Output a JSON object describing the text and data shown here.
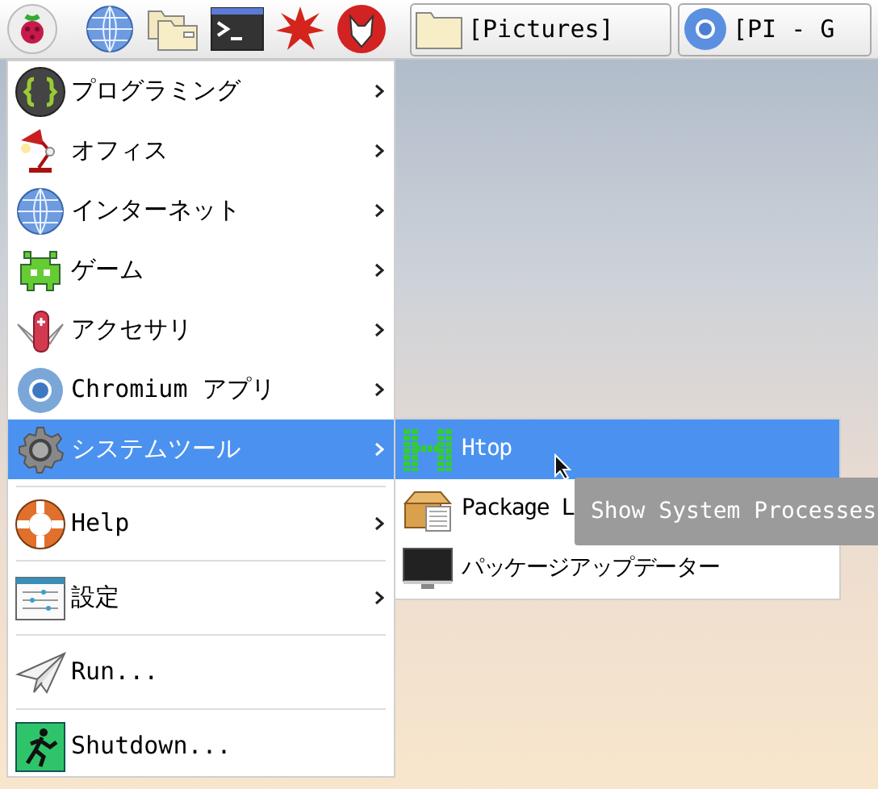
{
  "taskbar": {
    "tasks": [
      {
        "label": "[Pictures]",
        "selected": false
      },
      {
        "label": "[PI - G",
        "selected": false
      }
    ]
  },
  "menu": {
    "groups": [
      [
        {
          "label": "プログラミング",
          "has_submenu": true,
          "selected": false
        },
        {
          "label": "オフィス",
          "has_submenu": true,
          "selected": false
        },
        {
          "label": "インターネット",
          "has_submenu": true,
          "selected": false
        },
        {
          "label": "ゲーム",
          "has_submenu": true,
          "selected": false
        },
        {
          "label": "アクセサリ",
          "has_submenu": true,
          "selected": false
        },
        {
          "label": "Chromium アプリ",
          "has_submenu": true,
          "selected": false
        },
        {
          "label": "システムツール",
          "has_submenu": true,
          "selected": true
        }
      ],
      [
        {
          "label": "Help",
          "has_submenu": true,
          "selected": false
        }
      ],
      [
        {
          "label": "設定",
          "has_submenu": true,
          "selected": false
        }
      ],
      [
        {
          "label": "Run...",
          "has_submenu": false,
          "selected": false
        }
      ],
      [
        {
          "label": "Shutdown...",
          "has_submenu": false,
          "selected": false
        }
      ]
    ]
  },
  "submenu": {
    "items": [
      {
        "label": "Htop",
        "selected": true
      },
      {
        "label": "Package L",
        "selected": false
      },
      {
        "label": "パッケージアップデーター",
        "selected": false
      }
    ]
  },
  "tooltip": {
    "text": "Show System Processes"
  }
}
